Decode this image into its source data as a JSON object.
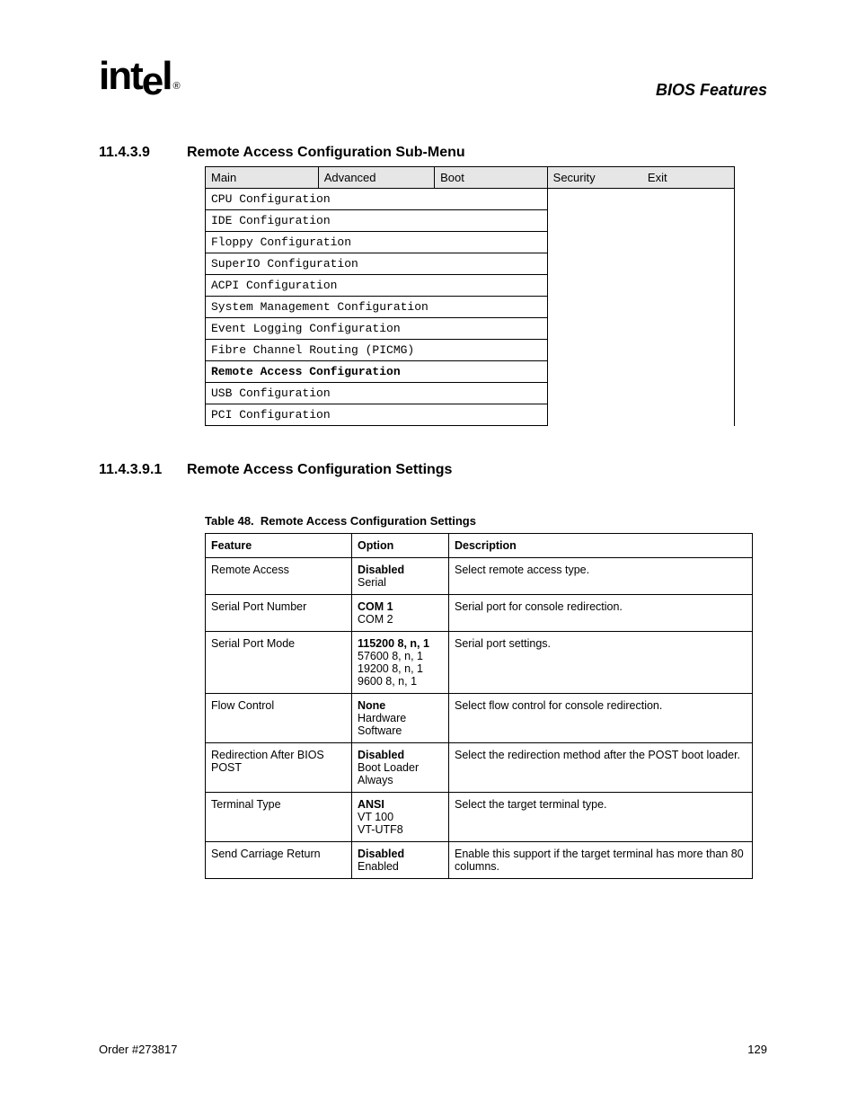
{
  "doc_title": "BIOS Features",
  "section1": {
    "num": "11.4.3.9",
    "title": "Remote Access Configuration Sub-Menu"
  },
  "section2": {
    "num": "11.4.3.9.1",
    "title": "Remote Access Configuration Settings"
  },
  "menu": {
    "tabs": [
      "Main",
      "Advanced",
      "Boot",
      "Security",
      "Exit"
    ],
    "items": [
      "CPU Configuration",
      "IDE Configuration",
      "Floppy Configuration",
      "SuperIO Configuration",
      "ACPI Configuration",
      "System Management Configuration",
      "Event Logging Configuration",
      "Fibre Channel Routing (PICMG)",
      "Remote Access Configuration",
      "USB Configuration",
      "PCI Configuration"
    ]
  },
  "table": {
    "caption_num": "Table 48.",
    "caption_title": "Remote Access Configuration Settings",
    "headers": [
      "Feature",
      "Option",
      "Description"
    ],
    "rows": [
      {
        "feature": "Remote Access",
        "options": [
          "Disabled",
          "Serial"
        ],
        "desc": "Select remote access type."
      },
      {
        "feature": "Serial Port Number",
        "options": [
          "COM 1",
          "COM 2"
        ],
        "desc": "Serial port for console redirection."
      },
      {
        "feature": "Serial Port Mode",
        "options": [
          "115200 8, n, 1",
          "57600 8, n, 1",
          "19200 8, n, 1",
          "9600 8, n, 1"
        ],
        "desc": "Serial port settings."
      },
      {
        "feature": "Flow Control",
        "options": [
          "None",
          "Hardware",
          "Software"
        ],
        "desc": "Select flow control for console redirection."
      },
      {
        "feature": "Redirection After BIOS POST",
        "options": [
          "Disabled",
          "Boot Loader",
          "Always"
        ],
        "desc": "Select the redirection method after the POST boot loader."
      },
      {
        "feature": "Terminal Type",
        "options": [
          "ANSI",
          "VT 100",
          "VT-UTF8"
        ],
        "desc": "Select the target terminal type."
      },
      {
        "feature": "Send Carriage Return",
        "options": [
          "Disabled",
          "Enabled"
        ],
        "desc": "Enable this support if the target terminal has more than 80 columns."
      }
    ]
  },
  "footer": {
    "order": "Order #273817",
    "page": "129"
  }
}
